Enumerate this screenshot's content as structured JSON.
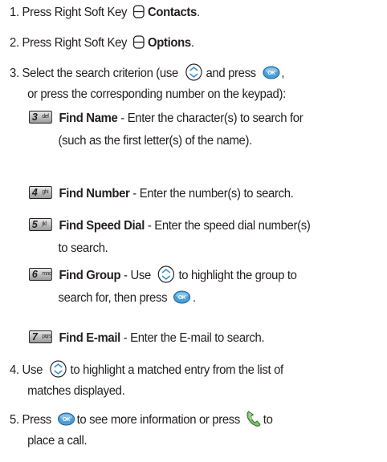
{
  "steps": [
    {
      "num": "1.",
      "pre": "Press Right Soft Key",
      "bold": "Contacts",
      "post": "."
    },
    {
      "num": "2.",
      "pre": "Press Right Soft Key",
      "bold": "Options",
      "post": "."
    },
    {
      "num": "3.",
      "pre": "Select the search criterion (use",
      "mid": "and press",
      "post": ",",
      "line2": "or press the corresponding number on the keypad):"
    },
    {
      "num": "4.",
      "pre": "Use",
      "post": "to highlight a matched entry from the list of",
      "line2": "matches displayed."
    },
    {
      "num": "5.",
      "pre": "Press",
      "mid": "to see more information or press",
      "post": "to",
      "line2": "place a call."
    }
  ],
  "options": [
    {
      "key_digit": "3",
      "key_letters": "def",
      "title": "Find Name",
      "desc": " - Enter the character(s) to search for",
      "line2": "(such as the first letter(s) of the name)."
    },
    {
      "key_digit": "4",
      "key_letters": "ghi",
      "title": "Find Number",
      "desc": " - Enter the number(s) to search."
    },
    {
      "key_digit": "5",
      "key_letters": "jkl",
      "title": "Find Speed Dial",
      "desc": " - Enter the speed dial number(s)",
      "line2": "to search."
    },
    {
      "key_digit": "6",
      "key_letters": "mno",
      "title": "Find Group",
      "desc_pre": " - Use",
      "desc_mid": "to highlight the group to",
      "line2_pre": "search for, then press",
      "line2_post": "."
    },
    {
      "key_digit": "7",
      "key_letters": "pqrs",
      "title": "Find E-mail",
      "desc": " - Enter the E-mail to search."
    }
  ],
  "icons": {
    "soft_key": "right-soft-key-icon",
    "navigation": "navigation-key-icon",
    "ok": "ok-key-icon",
    "send": "send-key-icon"
  },
  "colors": {
    "text": "#231f20",
    "key_border": "#231f20",
    "icon_blue": "#3a8fc8"
  }
}
